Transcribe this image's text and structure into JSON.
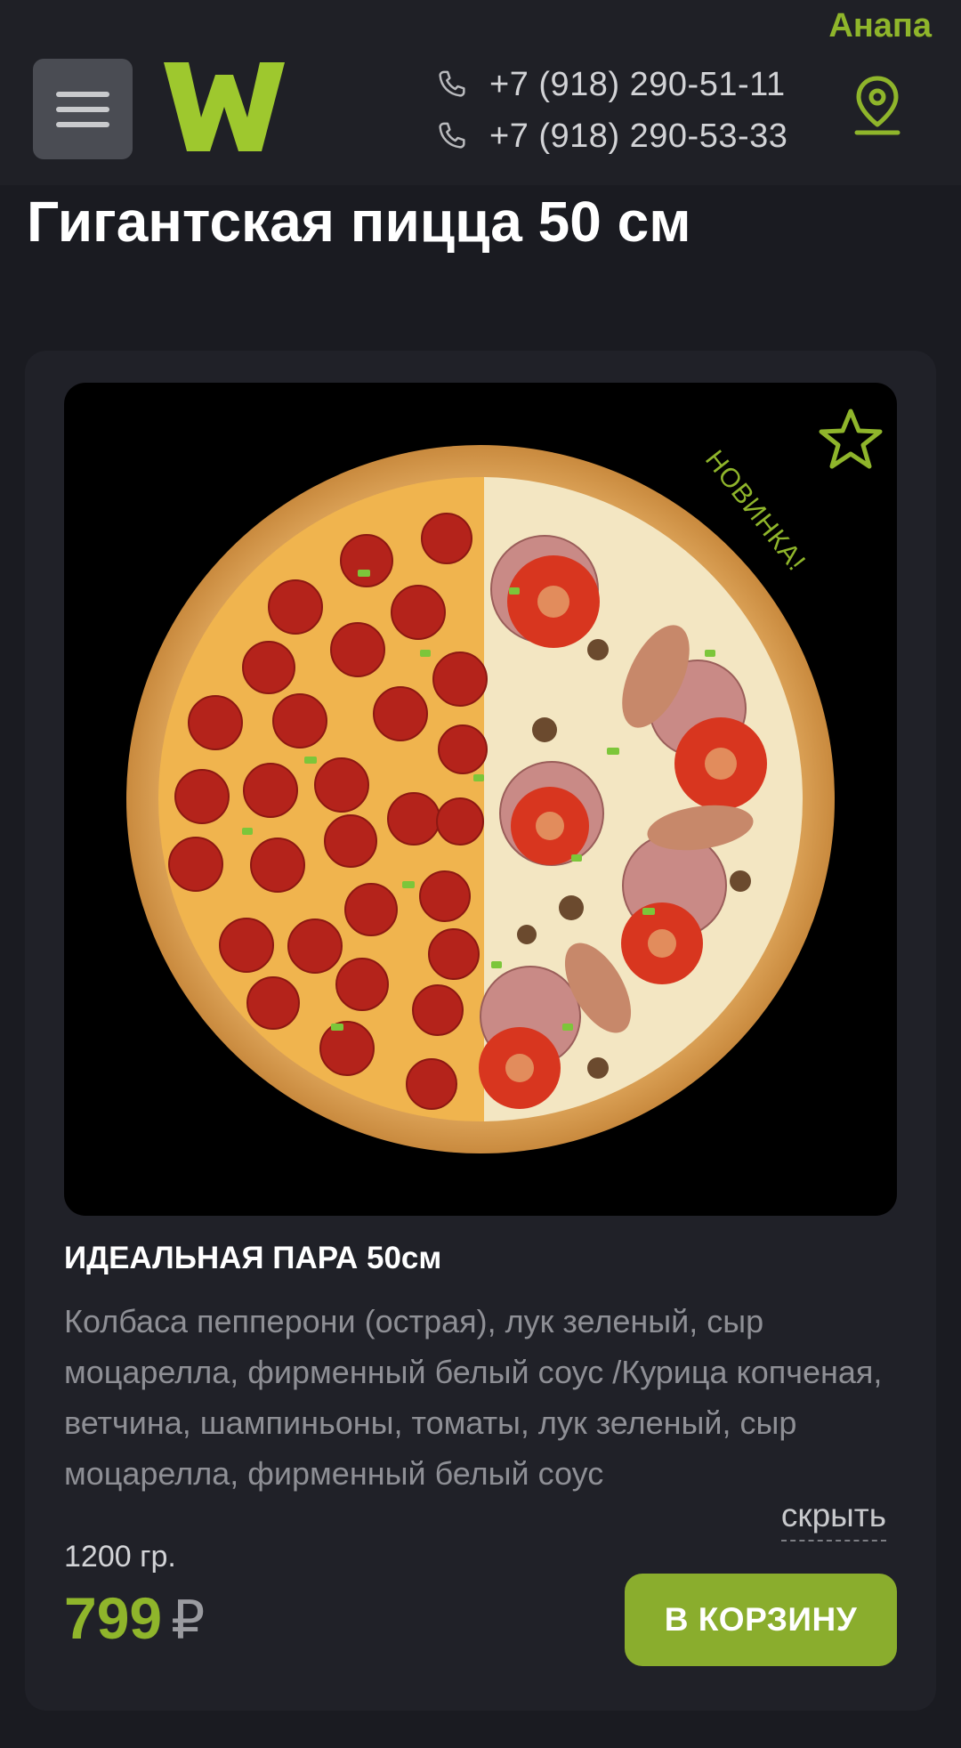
{
  "header": {
    "city": "Анапа",
    "phones": [
      "+7 (918) 290-51-11",
      "+7 (918) 290-53-33"
    ],
    "logo_text": "W"
  },
  "page_title": "Гигантская пицца 50 см",
  "product": {
    "badge": "НОВИНКА!",
    "name": "ИДЕАЛЬНАЯ ПАРА 50см",
    "description": "Колбаса пепперони (острая), лук зеленый, сыр моцарелла, фирменный белый соус /Курица копченая, ветчина, шампиньоны, томаты, лук зеленый, сыр моцарелла, фирменный белый соус",
    "toggle_label": "скрыть",
    "weight": "1200 гр.",
    "price": "799",
    "currency": "₽",
    "cart_button": "В КОРЗИНУ"
  },
  "colors": {
    "accent": "#8fb52b",
    "background": "#1a1b21",
    "card": "#202128"
  },
  "icons": [
    "menu-icon",
    "phone-icon",
    "location-pin-icon",
    "star-icon"
  ]
}
